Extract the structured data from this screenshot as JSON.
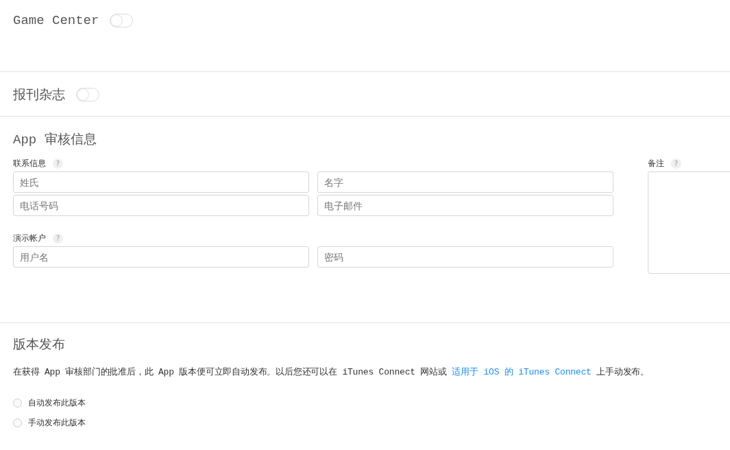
{
  "sections": [
    {
      "kind": "toggle",
      "title": "Game Center",
      "on": false
    },
    {
      "kind": "toggle",
      "title": "报刊杂志",
      "on": false
    }
  ],
  "review": {
    "title": "App 审核信息",
    "contact": {
      "label": "联系信息",
      "help": "?",
      "fields": [
        {
          "placeholder": "姓氏"
        },
        {
          "placeholder": "名字"
        },
        {
          "placeholder": "电话号码"
        },
        {
          "placeholder": "电子邮件"
        }
      ]
    },
    "demo": {
      "label": "演示帐户",
      "help": "?",
      "fields": [
        {
          "placeholder": "用户名"
        },
        {
          "placeholder": "密码"
        }
      ]
    },
    "notes": {
      "label": "备注",
      "help": "?"
    }
  },
  "release": {
    "title": "版本发布",
    "text_before": "在获得 App 审核部门的批准后，此 App 版本便可立即自动发布。以后您还可以在 iTunes Connect 网站或 ",
    "link": "适用于 iOS 的 iTunes Connect",
    "text_after": " 上手动发布。",
    "options": [
      {
        "label": "自动发布此版本",
        "selected": false
      },
      {
        "label": "手动发布此版本",
        "selected": false
      }
    ]
  }
}
